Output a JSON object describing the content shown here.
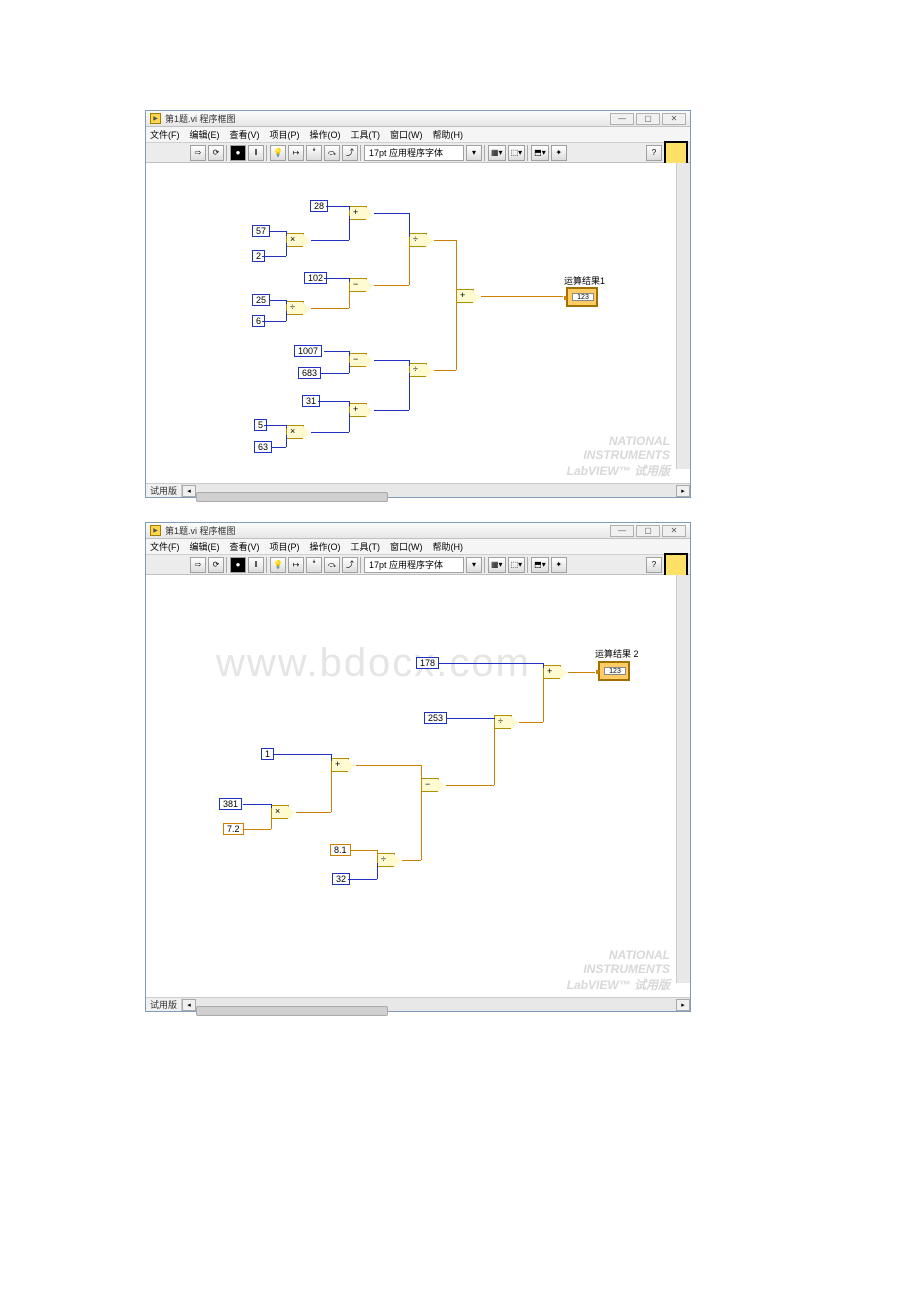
{
  "watermark": "www.bdocx.com",
  "win1": {
    "title": "第1题.vi 程序框图",
    "sys": {
      "min": "—",
      "max": "▢",
      "close": "✕"
    },
    "menu": [
      "文件(F)",
      "编辑(E)",
      "查看(V)",
      "项目(P)",
      "操作(O)",
      "工具(T)",
      "窗口(W)",
      "帮助(H)"
    ],
    "font": "17pt 应用程序字体",
    "status": "试用版",
    "indicator": {
      "label": "运算结果1",
      "placeholder": "123"
    },
    "constants": {
      "c28": "28",
      "c57": "57",
      "c2": "2",
      "c102": "102",
      "c25": "25",
      "c6": "6",
      "c1007": "1007",
      "c683": "683",
      "c31": "31",
      "c5": "5",
      "c63": "63"
    },
    "ops": {
      "add": "+",
      "sub": "−",
      "mul": "×",
      "div": "÷"
    },
    "ni": {
      "l1": "NATIONAL",
      "l2": "INSTRUMENTS",
      "l3": "LabVIEW™ 试用版"
    }
  },
  "win2": {
    "title": "第1题.vi 程序框图",
    "sys": {
      "min": "—",
      "max": "▢",
      "close": "✕"
    },
    "menu": [
      "文件(F)",
      "编辑(E)",
      "查看(V)",
      "项目(P)",
      "操作(O)",
      "工具(T)",
      "窗口(W)",
      "帮助(H)"
    ],
    "font": "17pt 应用程序字体",
    "status": "试用版",
    "indicator": {
      "label": "运算结果 2",
      "placeholder": "123"
    },
    "constants": {
      "c178": "178",
      "c253": "253",
      "c1": "1",
      "c381": "381",
      "c72": "7.2",
      "c81": "8.1",
      "c32": "32"
    },
    "ops": {
      "add": "+",
      "sub": "−",
      "mul": "×",
      "div": "÷"
    },
    "ni": {
      "l1": "NATIONAL",
      "l2": "INSTRUMENTS",
      "l3": "LabVIEW™ 试用版"
    }
  }
}
